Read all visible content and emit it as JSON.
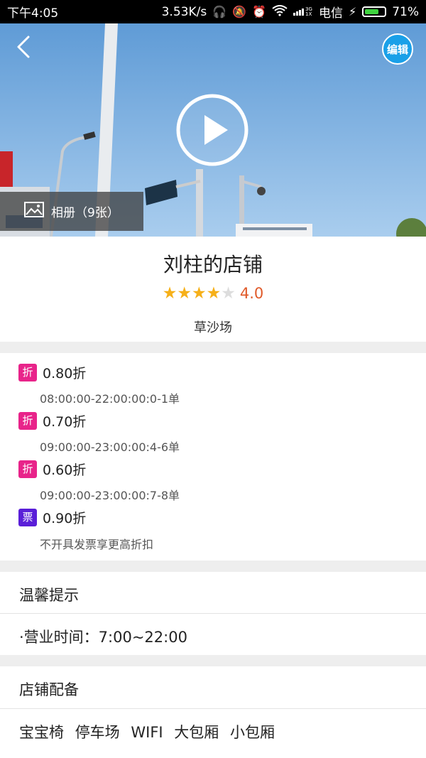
{
  "statusbar": {
    "time": "下午4:05",
    "speed": "3.53K/s",
    "carrier": "电信",
    "battery": "71%",
    "battery_level": 0.71
  },
  "hero": {
    "edit_label": "编辑",
    "album_label": "相册（9张）"
  },
  "shop": {
    "name": "刘柱的店铺",
    "rating_value": "4.0",
    "stars_filled": 4,
    "stars_total": 5,
    "location": "草沙场"
  },
  "discounts": [
    {
      "badge": "折",
      "type": "zhe",
      "title": "0.80折",
      "subtitle": "08:00:00-22:00:00:0-1单"
    },
    {
      "badge": "折",
      "type": "zhe",
      "title": "0.70折",
      "subtitle": "09:00:00-23:00:00:4-6单"
    },
    {
      "badge": "折",
      "type": "zhe",
      "title": "0.60折",
      "subtitle": "09:00:00-23:00:00:7-8单"
    },
    {
      "badge": "票",
      "type": "piao",
      "title": "0.90折",
      "subtitle": "不开具发票享更高折扣"
    }
  ],
  "tips": {
    "title": "温馨提示",
    "hours": "·营业时间：7:00~22:00"
  },
  "facilities": {
    "title": "店铺配备",
    "items": [
      "宝宝椅",
      "停车场",
      "WIFI",
      "大包厢",
      "小包厢"
    ]
  },
  "colors": {
    "discount_badge": "#e8248a",
    "invoice_badge": "#5a1fd8",
    "star": "#f6b019",
    "rating_text": "#e05a2a",
    "edit_button": "#1aa0e8"
  }
}
